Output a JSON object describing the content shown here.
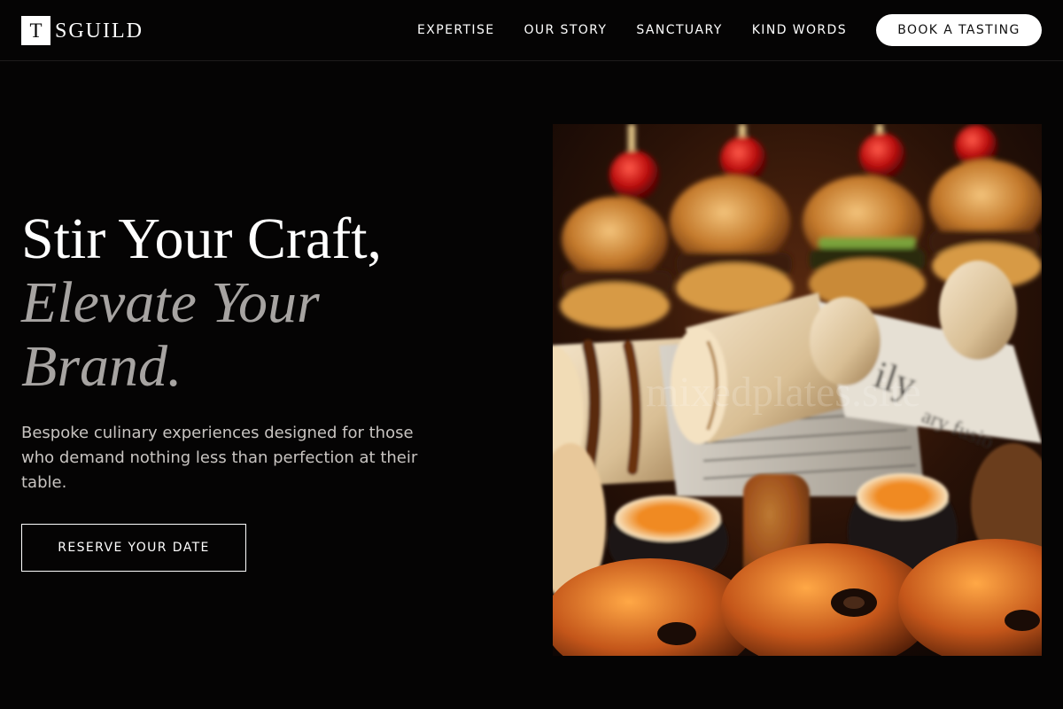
{
  "brand": {
    "mark": "T",
    "name": "SGUILD"
  },
  "nav": {
    "links": [
      "EXPERTISE",
      "OUR STORY",
      "SANCTUARY",
      "KIND WORDS"
    ],
    "cta_label": "BOOK A TASTING"
  },
  "hero": {
    "headline_line1": "Stir Your Craft,",
    "headline_line2": "Elevate Your",
    "headline_line3": "Brand.",
    "description": "Bespoke culinary experiences designed for those who demand nothing less than perfection at their table.",
    "button_label": "RESERVE YOUR DATE"
  },
  "hero_image": {
    "subject": "catering platter with slider burgers on skewers, newspaper-wrapped grilled wraps, sesame sushi rolls and olive focaccia",
    "watermark": "mixedplates.site"
  },
  "colors": {
    "background": "#050404",
    "text": "#ffffff",
    "accent_muted": "#a7a4a2",
    "body_text": "#c8c4c1",
    "cta_background": "#ffffff"
  }
}
